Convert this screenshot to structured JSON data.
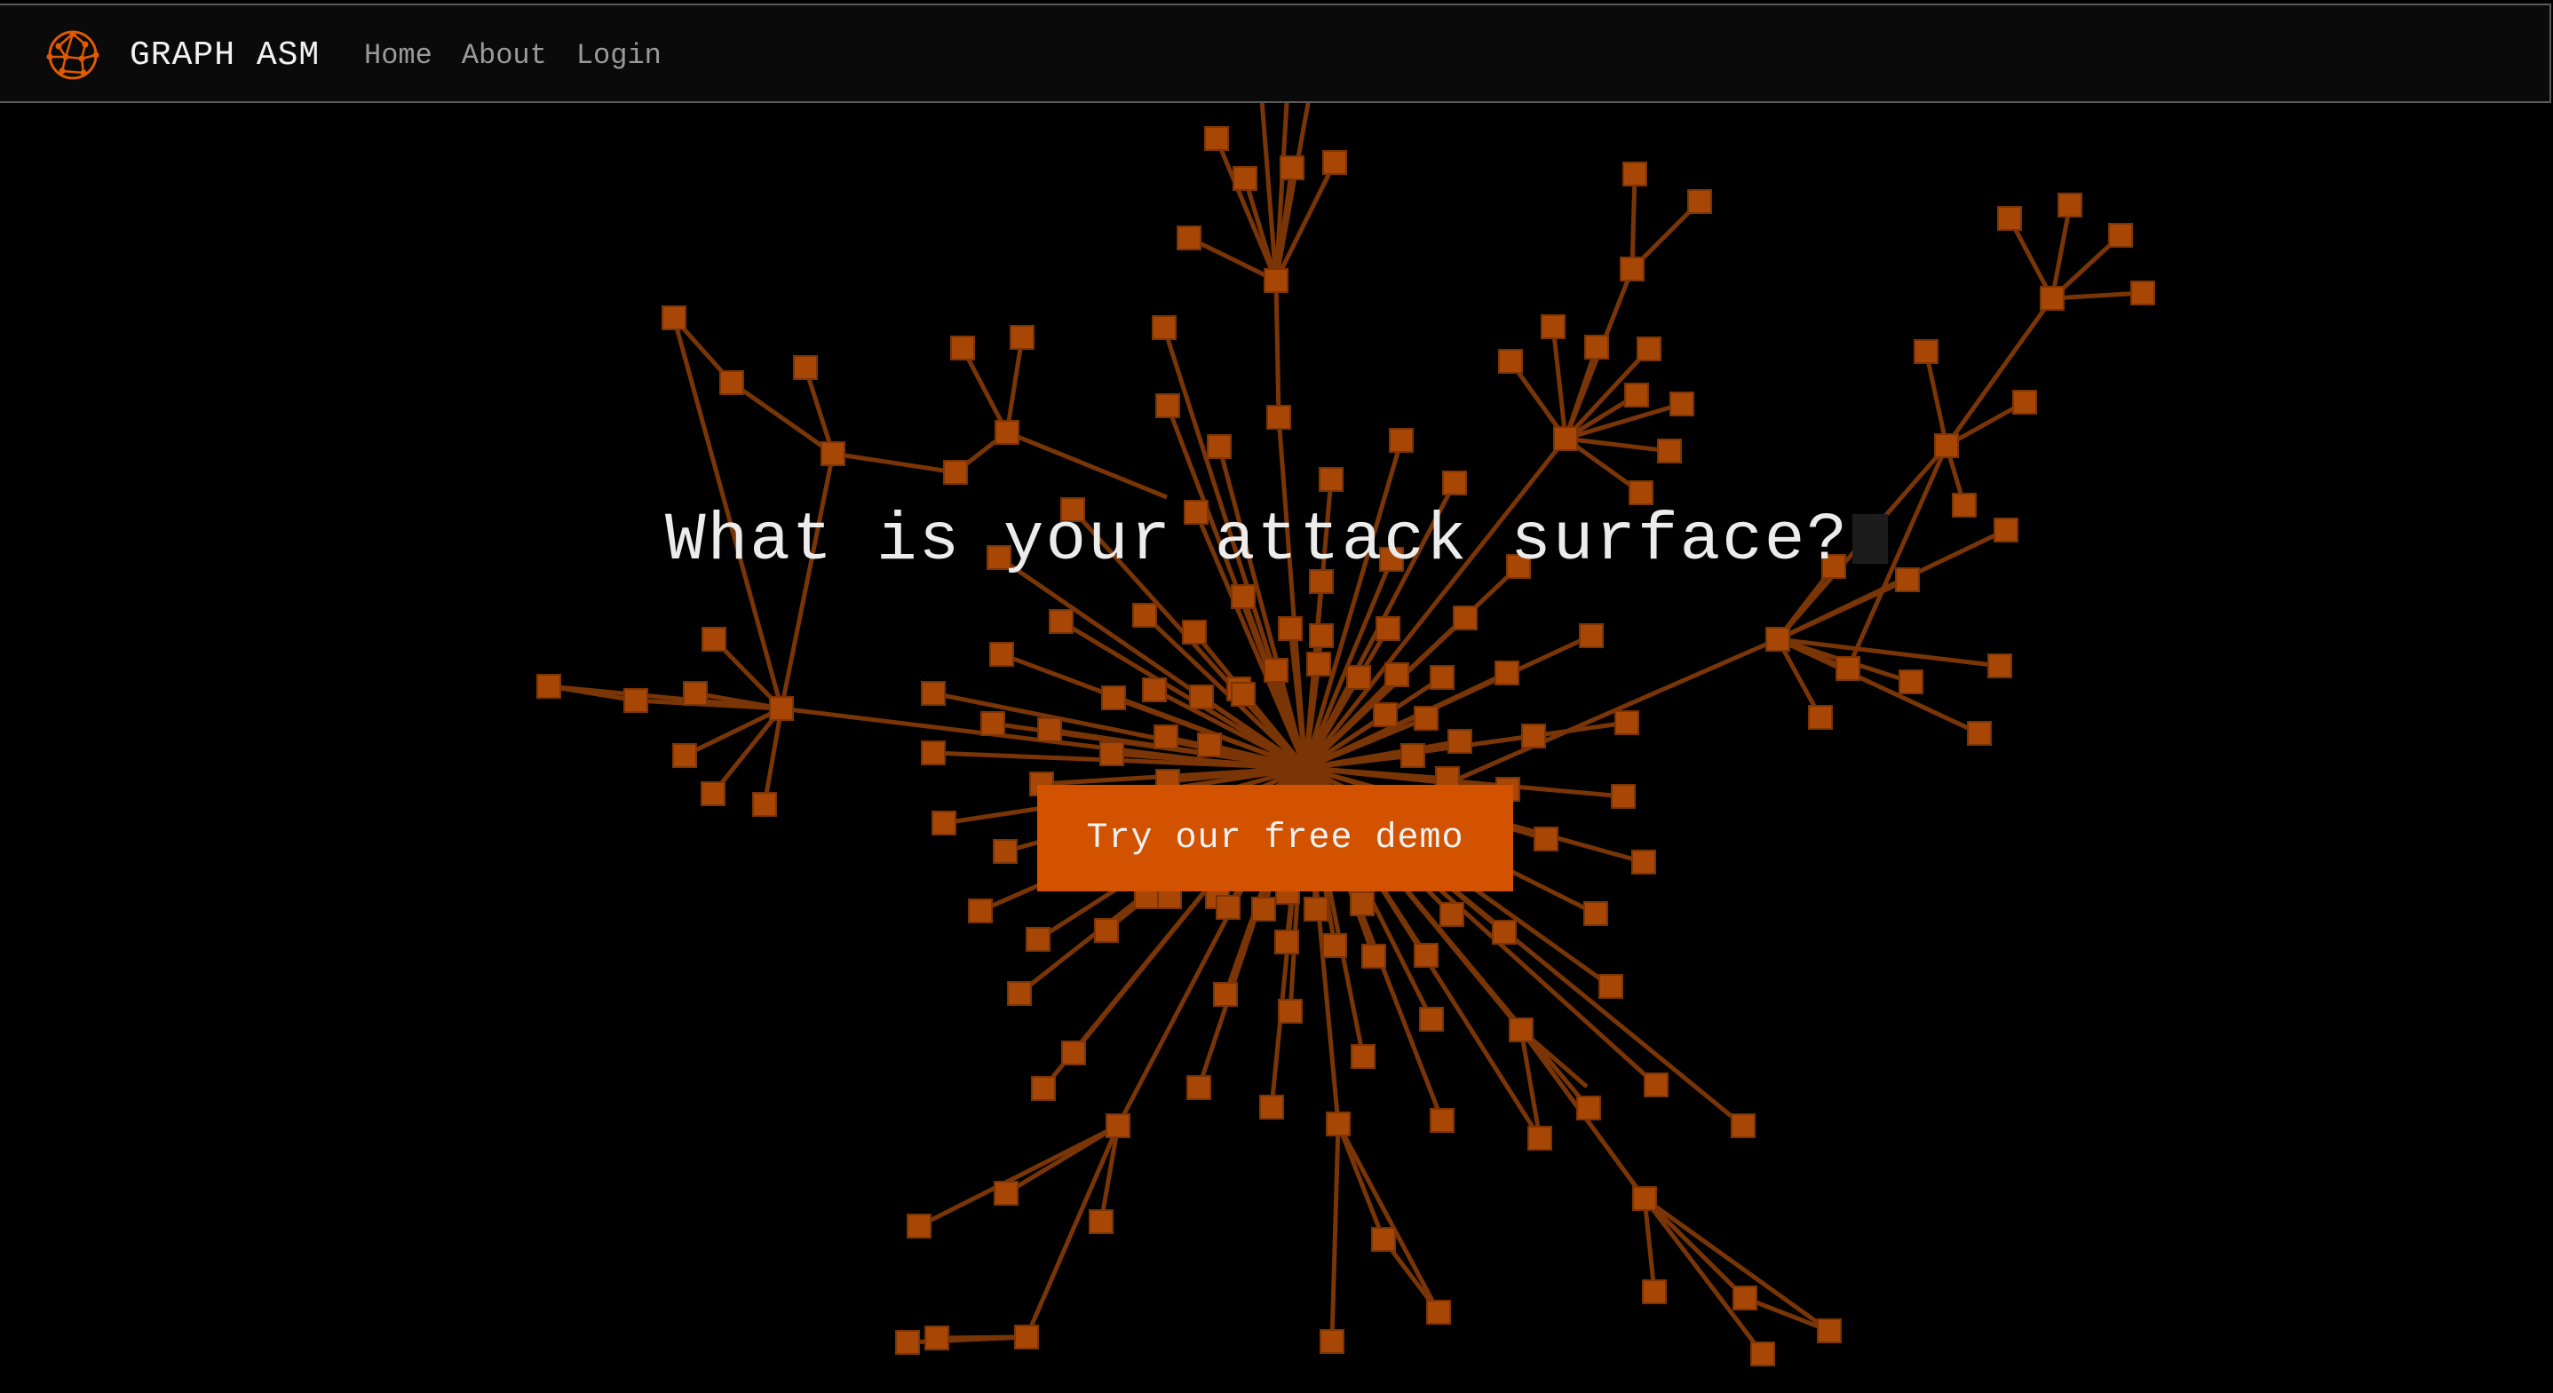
{
  "navbar": {
    "brand_name": "GRAPH ASM",
    "logo_icon": "graph-network-icon",
    "links": [
      {
        "label": "Home"
      },
      {
        "label": "About"
      },
      {
        "label": "Login"
      }
    ]
  },
  "hero": {
    "heading": "What is your attack surface?",
    "cta_label": "Try our free demo"
  },
  "colors": {
    "accent": "#d25200",
    "node": "#a84606",
    "edge": "#7a3507",
    "background": "#000000",
    "navbar_bg": "#0a0a0a"
  }
}
